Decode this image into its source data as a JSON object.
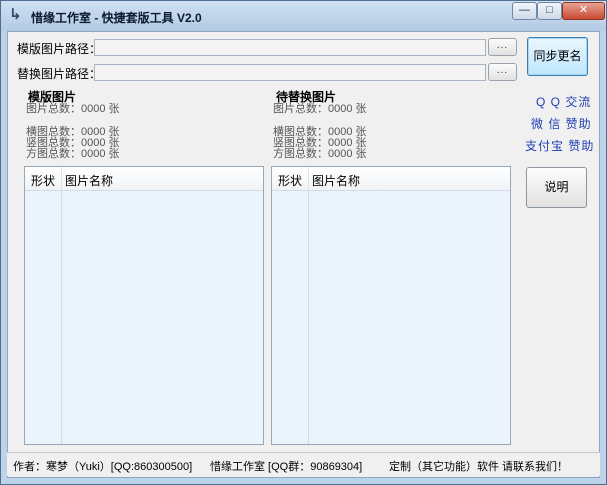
{
  "window": {
    "title": "惜缘工作室 - 快捷套版工具 V2.0",
    "minimize_glyph": "—",
    "maximize_glyph": "□",
    "close_glyph": "✕"
  },
  "paths": {
    "template_label": "模版图片路径：",
    "template_value": "",
    "replace_label": "替换图片路径：",
    "replace_value": "",
    "browse_label": "..."
  },
  "buttons": {
    "sync_rename": "同步更名",
    "help": "说明"
  },
  "links": {
    "qq": "Q Q 交流",
    "wechat": "微 信 赞助",
    "alipay": "支付宝 赞助"
  },
  "left_panel": {
    "title": "模版图片",
    "total": "图片总数：0000 张",
    "landscape": "横图总数：0000 张",
    "portrait": "竖图总数：0000 张",
    "square": "方图总数：0000 张",
    "columns": [
      "形状",
      "图片名称"
    ]
  },
  "right_panel": {
    "title": "待替换图片",
    "total": "图片总数：0000 张",
    "landscape": "横图总数：0000 张",
    "portrait": "竖图总数：0000 张",
    "square": "方图总数：0000 张",
    "columns": [
      "形状",
      "图片名称"
    ]
  },
  "status": {
    "author": "作者：寒梦（Yuki）[QQ:860300500]",
    "studio": "惜缘工作室 [QQ群：90869304]",
    "custom": "定制（其它功能）软件 请联系我们！"
  }
}
